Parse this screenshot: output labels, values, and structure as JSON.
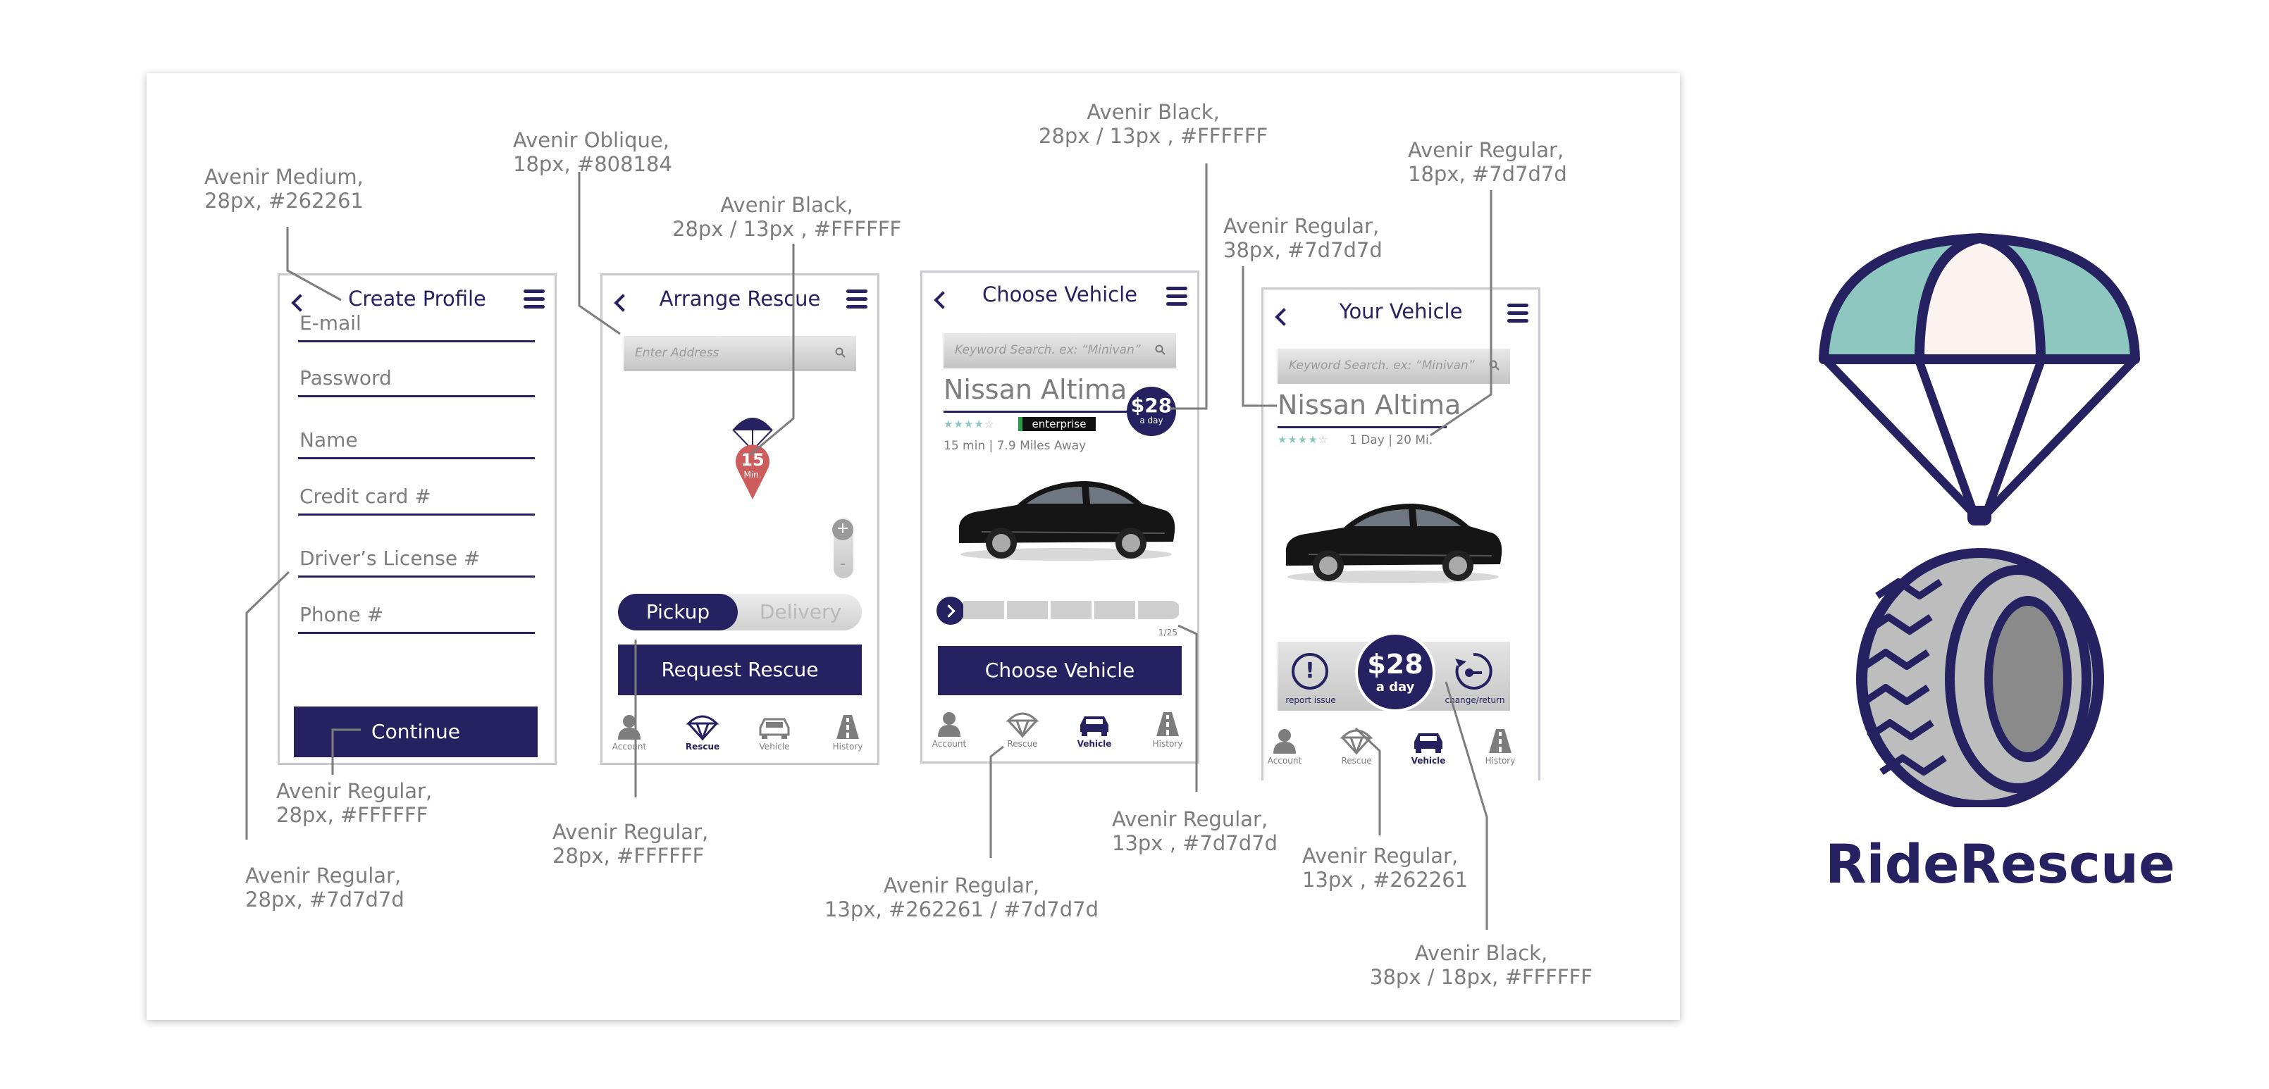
{
  "app_name": "RideRescue",
  "colors": {
    "primary": "#262261",
    "gray_text": "#7d7d7d",
    "mid_gray": "#808184",
    "teal": "#8ec7c0",
    "pin_red": "#cd5c5c",
    "pink": "#fbf3f0"
  },
  "screen1": {
    "title": "Create Profile",
    "fields": [
      "E-mail",
      "Password",
      "Name",
      "Credit card #",
      "Driver’s License #",
      "Phone #"
    ],
    "continue_label": "Continue"
  },
  "screen2": {
    "title": "Arrange Rescue",
    "search_placeholder": "Enter Address",
    "pin_minutes": "15",
    "pin_unit": "Min.",
    "zoom_in": "+",
    "zoom_out": "-",
    "toggle_selected": "Pickup",
    "toggle_other": "Delivery",
    "request_label": "Request Rescue",
    "tabs": [
      "Account",
      "Rescue",
      "Vehicle",
      "History"
    ]
  },
  "screen3": {
    "title": "Choose Vehicle",
    "search_placeholder": "Keyword Search.  ex: “Minivan”",
    "car_name": "Nissan Altima",
    "price": "$28",
    "per": "a day",
    "provider_logo_text": "enterprise",
    "rating": 4,
    "distance_text": "15 min | 7.9 Miles Away",
    "page_counter": "1/25",
    "choose_label": "Choose Vehicle",
    "tabs": [
      "Account",
      "Rescue",
      "Vehicle",
      "History"
    ]
  },
  "screen4": {
    "title": "Your Vehicle",
    "search_placeholder": "Keyword Search.  ex: “Minivan”",
    "car_name": "Nissan Altima",
    "rating": 4,
    "duration_text": "1 Day | 20 Mi.",
    "price": "$28",
    "per": "a day",
    "report_label": "report issue",
    "change_label": "change/return",
    "tabs": [
      "Account",
      "Rescue",
      "Vehicle",
      "History"
    ]
  },
  "annotations": {
    "a1": {
      "l1": "Avenir Medium,",
      "l2": "28px, #262261"
    },
    "a2": {
      "l1": "Avenir Oblique,",
      "l2": "18px, #808184"
    },
    "a3": {
      "l1": "Avenir Black,",
      "l2": "28px / 13px , #FFFFFF"
    },
    "a4": {
      "l1": "Avenir Black,",
      "l2": "28px / 13px , #FFFFFF"
    },
    "a5": {
      "l1": "Avenir Regular,",
      "l2": "38px, #7d7d7d"
    },
    "a6": {
      "l1": "Avenir Regular,",
      "l2": "18px, #7d7d7d"
    },
    "a7": {
      "l1": "Avenir Regular,",
      "l2": "28px, #FFFFFF"
    },
    "a8": {
      "l1": "Avenir Regular,",
      "l2": "28px, #7d7d7d"
    },
    "a9": {
      "l1": "Avenir Regular,",
      "l2": "28px, #FFFFFF"
    },
    "a10": {
      "l1": "Avenir Regular,",
      "l2": "13px, #262261 / #7d7d7d"
    },
    "a11": {
      "l1": "Avenir Regular,",
      "l2": "13px , #7d7d7d"
    },
    "a12": {
      "l1": "Avenir Regular,",
      "l2": "13px , #262261"
    },
    "a13": {
      "l1": "Avenir Black,",
      "l2": "38px / 18px, #FFFFFF"
    }
  }
}
